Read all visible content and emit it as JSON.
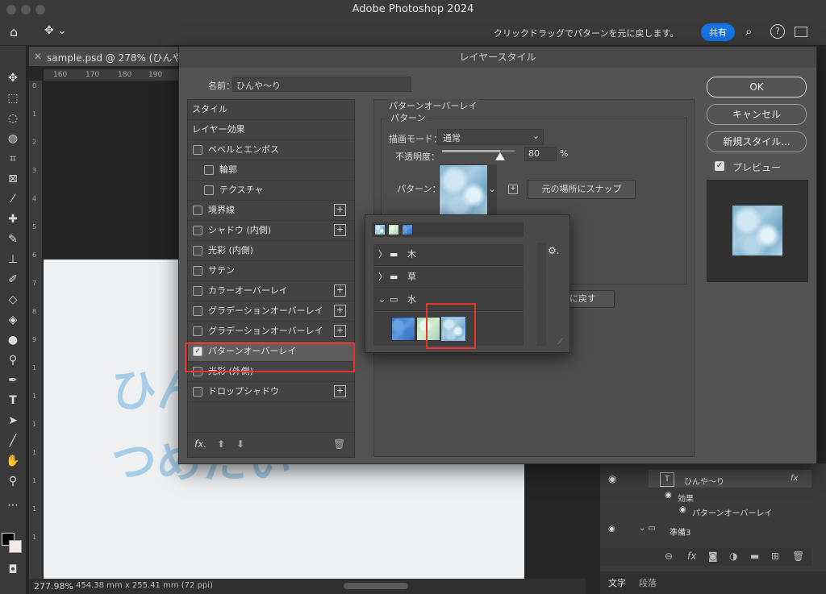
{
  "window": {
    "title": "Adobe Photoshop 2024"
  },
  "optbar": {
    "hint": "クリックドラッグでパターンを元に戻します。",
    "share_label": "共有"
  },
  "document": {
    "tab_label": "sample.psd @ 278% (ひんや〜",
    "ruler_top": [
      "160",
      "170",
      "180",
      "190"
    ],
    "ruler_left": [
      "0",
      "1",
      "2",
      "3",
      "4",
      "5",
      "6",
      "7",
      "8",
      "9",
      "1",
      "1",
      "1",
      "1",
      "1",
      "1",
      "1"
    ],
    "canvas_text": [
      "ひん",
      "つめたい"
    ],
    "status": {
      "zoom": "277.98%",
      "size": "454.38 mm x 255.41 mm (72 ppi)"
    }
  },
  "dialog": {
    "title": "レイヤースタイル",
    "name_label": "名前：",
    "name_value": "ひんや〜り",
    "buttons": {
      "ok": "OK",
      "cancel": "キャンセル",
      "new_style": "新規スタイル..."
    },
    "preview_label": "プレビュー",
    "styles": [
      {
        "label": "スタイル",
        "checkbox": false,
        "plus": false
      },
      {
        "label": "レイヤー効果",
        "checkbox": false,
        "plus": false
      },
      {
        "label": "ベベルとエンボス",
        "checkbox": true,
        "plus": false
      },
      {
        "label": "輪郭",
        "checkbox": true,
        "plus": false
      },
      {
        "label": "テクスチャ",
        "checkbox": true,
        "plus": false
      },
      {
        "label": "境界線",
        "checkbox": true,
        "plus": true
      },
      {
        "label": "シャドウ (内側)",
        "checkbox": true,
        "plus": true
      },
      {
        "label": "光彩 (内側)",
        "checkbox": true,
        "plus": false
      },
      {
        "label": "サテン",
        "checkbox": true,
        "plus": false
      },
      {
        "label": "カラーオーバーレイ",
        "checkbox": true,
        "plus": true
      },
      {
        "label": "グラデーションオーバーレイ",
        "checkbox": true,
        "plus": true
      },
      {
        "label": "グラデーションオーバーレイ",
        "checkbox": true,
        "plus": true
      },
      {
        "label": "パターンオーバーレイ",
        "checkbox": true,
        "plus": false,
        "checked": true
      },
      {
        "label": "光彩 (外側)",
        "checkbox": true,
        "plus": false
      },
      {
        "label": "ドロップシャドウ",
        "checkbox": true,
        "plus": true
      }
    ],
    "settings": {
      "section_title": "パターンオーバーレイ",
      "group_title": "パターン",
      "blend_label": "描画モード：",
      "blend_value": "通常",
      "opacity_label": "不透明度：",
      "opacity_value": "80",
      "opacity_unit": "%",
      "opacity_level": 0.8,
      "pattern_label": "パターン：",
      "snap_button": "元の場所にスナップ",
      "reset_button_fragment": "定に戻す"
    },
    "pattern_popup": {
      "folders": [
        {
          "name": "木",
          "expanded": false
        },
        {
          "name": "草",
          "expanded": false
        },
        {
          "name": "水",
          "expanded": true
        }
      ]
    }
  },
  "layers": {
    "rows": [
      {
        "name": "ひんや〜り",
        "kind": "text",
        "fx": "fx"
      },
      {
        "name": "効果",
        "kind": "effects"
      },
      {
        "name": "パターンオーバーレイ",
        "kind": "effect"
      },
      {
        "name": "準備3",
        "kind": "group"
      }
    ],
    "tabs": [
      "文字",
      "段落"
    ]
  },
  "colors": {
    "accent": "#1473e6",
    "highlight": "#e8372c"
  }
}
